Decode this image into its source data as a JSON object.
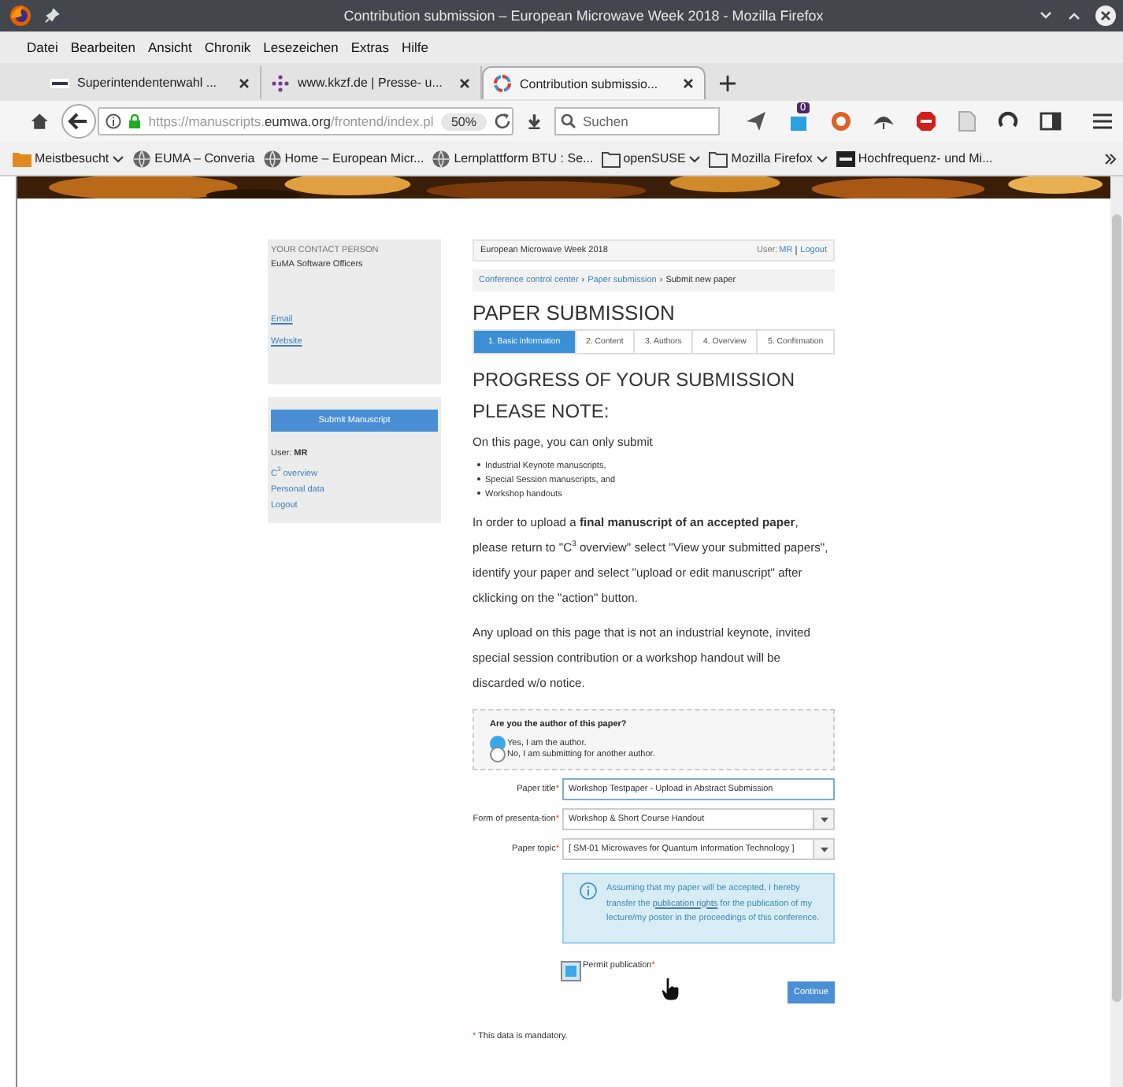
{
  "window": {
    "title": "Contribution submission – European Microwave Week 2018 - Mozilla Firefox"
  },
  "menu": [
    "Datei",
    "Bearbeiten",
    "Ansicht",
    "Chronik",
    "Lesezeichen",
    "Extras",
    "Hilfe"
  ],
  "tabs": [
    {
      "label": "Superintendentenwahl ...",
      "selected": false,
      "kind": "maz"
    },
    {
      "label": "www.kkzf.de | Presse- u...",
      "selected": false,
      "kind": "dots"
    },
    {
      "label": "Contribution submissio...",
      "selected": true,
      "kind": "ring"
    }
  ],
  "nav": {
    "url": "https://manuscripts.**eumwa.org**/frontend/index.pl",
    "zoom": "50%",
    "search_placeholder": "Suchen",
    "badge": "0"
  },
  "bookmarks": [
    {
      "label": "Meistbesucht",
      "kind": "star",
      "dropdown": true
    },
    {
      "label": "EUMA – Converia",
      "kind": "globe",
      "dropdown": false
    },
    {
      "label": "Home – European Micr...",
      "kind": "globe",
      "dropdown": false
    },
    {
      "label": "Lernplattform BTU : Se...",
      "kind": "globe",
      "dropdown": false
    },
    {
      "label": "openSUSE",
      "kind": "folder",
      "dropdown": true
    },
    {
      "label": "Mozilla Firefox",
      "kind": "folder",
      "dropdown": true
    },
    {
      "label": "Hochfrequenz- und Mi...",
      "kind": "site",
      "dropdown": false
    }
  ],
  "sidebar": {
    "contact": {
      "heading": "YOUR CONTACT PERSON",
      "name": "EuMA Software Officers",
      "links": [
        "Email",
        "Website"
      ]
    },
    "account": {
      "button": "Submit Manuscript",
      "user_label": "User:",
      "user": "MR",
      "links": [
        "C$^{3}$ overview",
        "Personal data",
        "Logout"
      ]
    }
  },
  "main": {
    "header": {
      "site": "European Microwave Week 2018",
      "user_label": "User:",
      "user": "MR",
      "logout": "Logout"
    },
    "breadcrumb": {
      "separator": "›",
      "items": [
        "Conference control center",
        "Paper submission",
        "Submit new paper"
      ]
    },
    "title": "PAPER SUBMISSION",
    "steps": [
      {
        "label": "1. Basic information",
        "selected": true
      },
      {
        "label": "2. Content",
        "selected": false
      },
      {
        "label": "3. Authors",
        "selected": false
      },
      {
        "label": "4. Overview",
        "selected": false
      },
      {
        "label": "5. Confirmation",
        "selected": false
      }
    ],
    "progress_heading": "PROGRESS OF YOUR SUBMISSION",
    "note_heading": "PLEASE NOTE:",
    "intro": "On this page, you can only submit",
    "bullets": [
      "Industrial Keynote manuscripts,",
      "Special Session manuscripts, and",
      "Workshop handouts"
    ],
    "paragraphs": [
      "In order to upload a **final manuscript of an accepted paper**, please return to \"C$^{3}$ overview\" select \"View your submitted papers\", identify your paper and select \"upload or edit manuscript\" after cklicking on the \"action\" button.",
      "Any upload on this page that is not an industrial keynote, invited special session contribution or a workshop handout will be discarded w/o notice."
    ],
    "question": {
      "prompt": "Are you the author of this paper?",
      "options": [
        {
          "label": "Yes, I am the author.",
          "selected": true
        },
        {
          "label": "No, I am submitting for another author.",
          "selected": false
        }
      ]
    },
    "fields": [
      {
        "label": "Paper title",
        "mark": "*",
        "kind": "text",
        "value": "Workshop Testpaper - Upload in Abstract Submission"
      },
      {
        "label": "Form of presenta-tion",
        "mark": "*",
        "kind": "select",
        "value": "Workshop & Short Course Handout"
      },
      {
        "label": "Paper topic",
        "mark": "*",
        "kind": "select",
        "value": "[ SM-01 Microwaves for Quantum Information Technology ]"
      }
    ],
    "info": {
      "before": "Assuming that my paper will be accepted, I hereby transfer the",
      "link": "publication rights",
      "after": "for the publication of my lecture/my poster in the proceedings of this conference."
    },
    "permit": {
      "label": "Permit publication",
      "mark": "*",
      "checked": true
    },
    "continue": "Continue",
    "footnote": {
      "mark": "*",
      "text": "This data is mandatory."
    }
  }
}
